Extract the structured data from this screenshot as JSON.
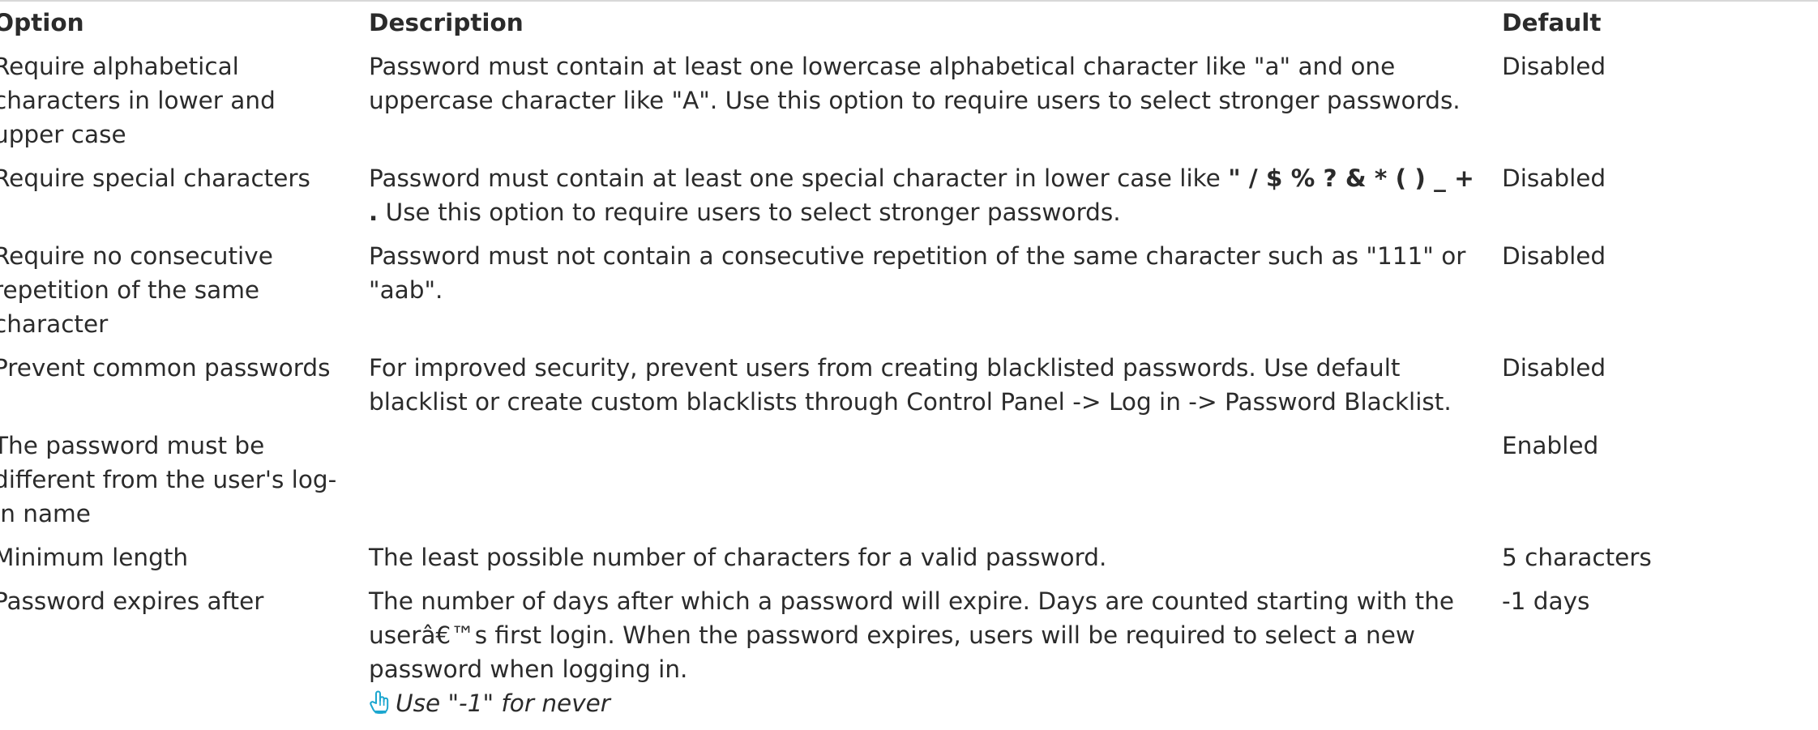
{
  "table": {
    "headers": {
      "option": "Option",
      "description": "Description",
      "default": "Default"
    },
    "rows": [
      {
        "option": "Require alphabetical characters in lower and upper case",
        "description": "Password must contain at least one lowercase alphabetical character like \"a\" and one uppercase character like \"A\". Use this option to require users to select stronger passwords.",
        "default": "Disabled"
      },
      {
        "option": "Require special characters",
        "description_pre": "Password must contain at least one special character in lower case like ",
        "description_chars": "\" / $ % ? & * ( ) _ + .",
        "description_post": " Use this option to require users to select stronger passwords.",
        "default": "Disabled"
      },
      {
        "option": "Require no consecutive repetition of the same character",
        "description": "Password must not contain a consecutive repetition of the same character such as \"111\" or \"aab\".",
        "default": "Disabled"
      },
      {
        "option": "Prevent common passwords",
        "description": "For improved security, prevent users from creating blacklisted passwords. Use default blacklist or create custom blacklists through Control Panel -> Log in -> Password Blacklist.",
        "default": "Disabled"
      },
      {
        "option": "The password must be different from the user's log-in name",
        "description": "",
        "default": "Enabled"
      },
      {
        "option": "Minimum length",
        "description": "The least possible number of characters for a valid password.",
        "default": "5 characters"
      },
      {
        "option": "Password expires after",
        "description": "The number of days after which a password will expire. Days are counted starting with the userâ€™s first login. When the password expires, users will be required to select a new password when logging in.",
        "note": "Use \"-1\" for never",
        "note_icon": "pointing-hand-icon",
        "default": "-1 days"
      }
    ]
  },
  "colors": {
    "text": "#2b2b2b",
    "icon_accent": "#1ba6cf",
    "rule": "#d8d8d8"
  }
}
